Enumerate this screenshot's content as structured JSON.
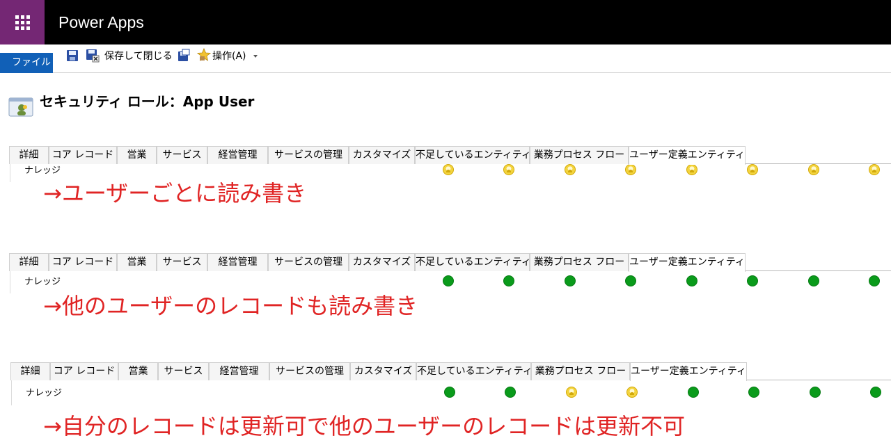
{
  "app": {
    "title": "Power Apps"
  },
  "commandbar": {
    "file_label": "ファイル",
    "save_close_label": "保存して閉じる",
    "actions_label": "操作(A)"
  },
  "page": {
    "title": "セキュリティ ロール：App User"
  },
  "tabs": [
    "詳細",
    "コア レコード",
    "営業",
    "サービス",
    "経営管理",
    "サービスの管理",
    "カスタマイズ",
    "不足しているエンティティ",
    "業務プロセス フロー",
    "ユーザー定義エンティティ"
  ],
  "active_tab": "ユーザー定義エンティティ",
  "panels": [
    {
      "entity_label": "ナレッジ",
      "privileges": [
        "user",
        "user",
        "user",
        "user",
        "user",
        "user",
        "user",
        "user"
      ],
      "annotation": "→ユーザーごとに読み書き"
    },
    {
      "entity_label": "ナレッジ",
      "privileges": [
        "organization",
        "organization",
        "organization",
        "organization",
        "organization",
        "organization",
        "organization",
        "organization"
      ],
      "annotation": "→他のユーザーのレコードも読み書き"
    },
    {
      "entity_label": "ナレッジ",
      "privileges": [
        "organization",
        "organization",
        "user",
        "user",
        "organization",
        "organization",
        "organization",
        "organization"
      ],
      "annotation": "→自分のレコードは更新可で他のユーザーのレコードは更新不可"
    }
  ],
  "colors": {
    "brand": "#742774",
    "topbar": "#000000",
    "file": "#1160b7",
    "annotation": "#e02424",
    "organization_dot": "#0a9b1b",
    "user_dot": "#f3d43e"
  },
  "icons": [
    "waffle-icon",
    "save-icon",
    "save-close-icon",
    "save-as-icon",
    "actions-icon",
    "security-role-icon",
    "user-privilege-icon",
    "organization-privilege-icon"
  ]
}
